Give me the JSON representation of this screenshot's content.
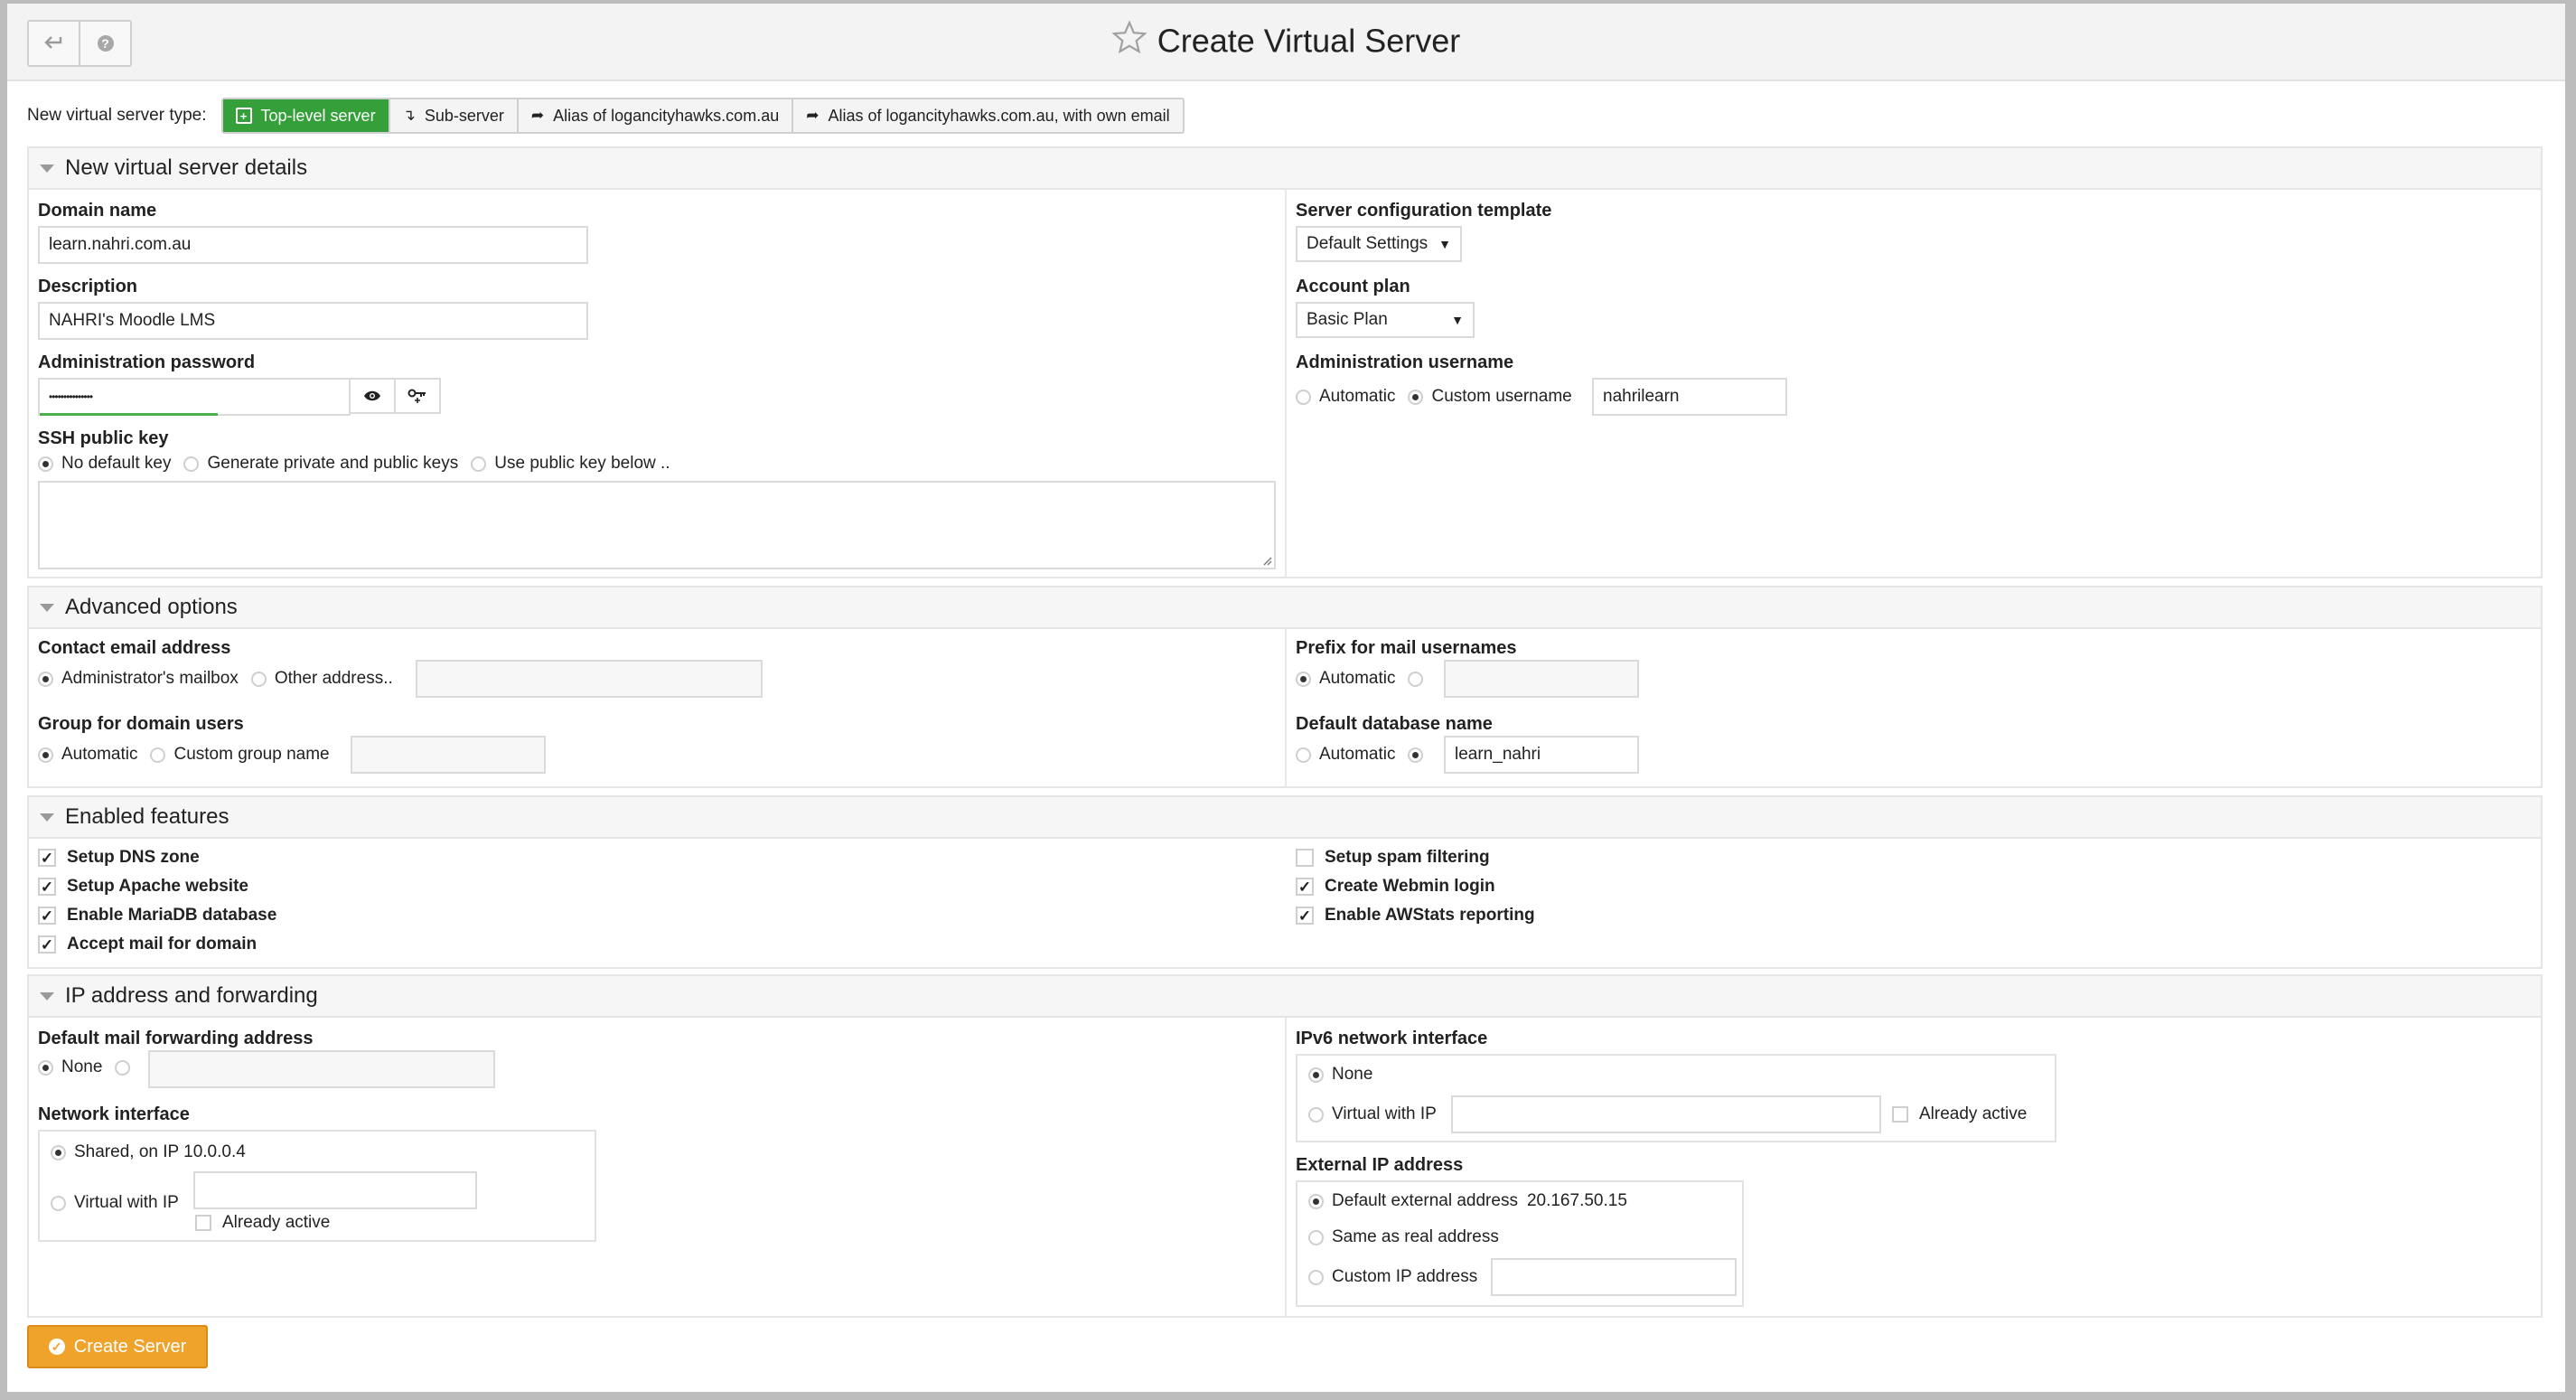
{
  "page_title": "Create Virtual Server",
  "toolbar": {
    "back_icon": "return-arrow-icon",
    "help_icon": "help-icon",
    "help_glyph": "?"
  },
  "server_type": {
    "label": "New virtual server type:",
    "options": [
      {
        "label": "Top-level server",
        "active": true,
        "icon": "plus-square-icon"
      },
      {
        "label": "Sub-server",
        "active": false,
        "icon": "sub-arrow-icon"
      },
      {
        "label": "Alias of logancityhawks.com.au",
        "active": false,
        "icon": "share-icon"
      },
      {
        "label": "Alias of logancityhawks.com.au, with own email",
        "active": false,
        "icon": "share-icon"
      }
    ],
    "active_color": "#35a03a"
  },
  "details": {
    "title": "New virtual server details",
    "domain": {
      "label": "Domain name",
      "value": "learn.nahri.com.au"
    },
    "description": {
      "label": "Description",
      "value": "NAHRI's Moodle LMS"
    },
    "password": {
      "label": "Administration password",
      "value": "•••••••••••••••",
      "strength": 0.5
    },
    "ssh": {
      "label": "SSH public key",
      "options": [
        "No default key",
        "Generate private and public keys",
        "Use public key below .."
      ],
      "selected": 0
    },
    "template": {
      "label": "Server configuration template",
      "value": "Default Settings"
    },
    "plan": {
      "label": "Account plan",
      "value": "Basic Plan"
    },
    "admin_user": {
      "label": "Administration username",
      "options": [
        "Automatic",
        "Custom username"
      ],
      "selected": 1,
      "value": "nahrilearn"
    }
  },
  "advanced": {
    "title": "Advanced options",
    "contact_email": {
      "label": "Contact email address",
      "options": [
        "Administrator's mailbox",
        "Other address.."
      ],
      "selected": 0
    },
    "group": {
      "label": "Group for domain users",
      "options": [
        "Automatic",
        "Custom group name"
      ],
      "selected": 0
    },
    "mail_prefix": {
      "label": "Prefix for mail usernames",
      "options": [
        "Automatic"
      ],
      "selected": 0
    },
    "db_name": {
      "label": "Default database name",
      "options": [
        "Automatic"
      ],
      "selected": 1,
      "value": "learn_nahri"
    }
  },
  "features": {
    "title": "Enabled features",
    "left": [
      {
        "label": "Setup DNS zone",
        "checked": true
      },
      {
        "label": "Setup Apache website",
        "checked": true
      },
      {
        "label": "Enable MariaDB database",
        "checked": true
      },
      {
        "label": "Accept mail for domain",
        "checked": true
      }
    ],
    "right": [
      {
        "label": "Setup spam filtering",
        "checked": false
      },
      {
        "label": "Create Webmin login",
        "checked": true
      },
      {
        "label": "Enable AWStats reporting",
        "checked": true
      }
    ]
  },
  "ip": {
    "title": "IP address and forwarding",
    "mail_fwd": {
      "label": "Default mail forwarding address",
      "options": [
        "None"
      ],
      "selected": 0
    },
    "network": {
      "label": "Network interface",
      "shared": "Shared, on IP 10.0.0.4",
      "virtual": "Virtual with IP",
      "already": "Already active",
      "selected": 0
    },
    "ipv6": {
      "label": "IPv6 network interface",
      "none": "None",
      "virtual": "Virtual with IP",
      "already": "Already active",
      "selected": 0
    },
    "external": {
      "label": "External IP address",
      "default": "Default external address",
      "default_value": "20.167.50.15",
      "same": "Same as real address",
      "custom": "Custom IP address",
      "selected": 0
    }
  },
  "create_button": {
    "label": "Create Server",
    "color": "#f0a32b"
  }
}
